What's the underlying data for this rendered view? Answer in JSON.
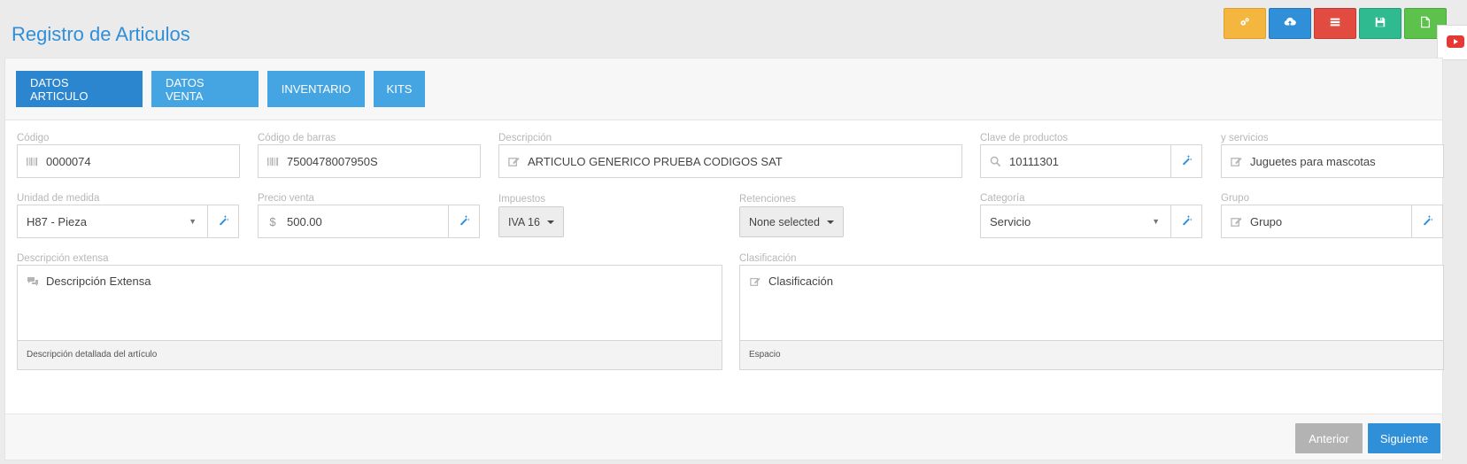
{
  "page": {
    "title": "Registro de Articulos"
  },
  "toolbar": {
    "buttons": [
      {
        "icon": "gears-icon",
        "color": "#f4b63f"
      },
      {
        "icon": "cloud-upload-icon",
        "color": "#2f8fd8"
      },
      {
        "icon": "list-icon",
        "color": "#e24b3f"
      },
      {
        "icon": "save-icon",
        "color": "#2fba8f"
      },
      {
        "icon": "new-file-icon",
        "color": "#5cc24b"
      }
    ]
  },
  "youtube": {
    "icon": "youtube-icon",
    "color": "#e53935"
  },
  "tabs": [
    {
      "label": "DATOS ARTICULO",
      "active": true
    },
    {
      "label": "DATOS VENTA",
      "active": false
    },
    {
      "label": "INVENTARIO",
      "active": false
    },
    {
      "label": "KITS",
      "active": false
    }
  ],
  "form": {
    "codigo": {
      "label": "Código",
      "value": "0000074"
    },
    "codigo_barras": {
      "label": "Código de barras",
      "value": "7500478007950S"
    },
    "descripcion": {
      "label": "Descripción",
      "value": "ARTICULO GENERICO PRUEBA CODIGOS SAT"
    },
    "clave_productos": {
      "label": "Clave de productos",
      "value": "10111301"
    },
    "servicios": {
      "label": "y servicios",
      "value": "Juguetes para mascotas"
    },
    "unidad": {
      "label": "Unidad de medida",
      "value": "H87 - Pieza"
    },
    "precio": {
      "label": "Precio venta",
      "symbol": "$",
      "value": "500.00"
    },
    "impuestos": {
      "label": "Impuestos",
      "value": "IVA 16"
    },
    "retenciones": {
      "label": "Retenciones",
      "value": "None selected"
    },
    "categoria": {
      "label": "Categoría",
      "value": "Servicio"
    },
    "grupo": {
      "label": "Grupo",
      "value": "Grupo"
    },
    "descripcion_extensa": {
      "label": "Descripción extensa",
      "value": "Descripción Extensa",
      "help": "Descripción detallada del artículo"
    },
    "clasificacion": {
      "label": "Clasificación",
      "value": "Clasificación",
      "help": "Espacio"
    }
  },
  "footer": {
    "prev_label": "Anterior",
    "next_label": "Siguiente",
    "prev_color": "#b3b3b3",
    "next_color": "#2f8fd8"
  }
}
